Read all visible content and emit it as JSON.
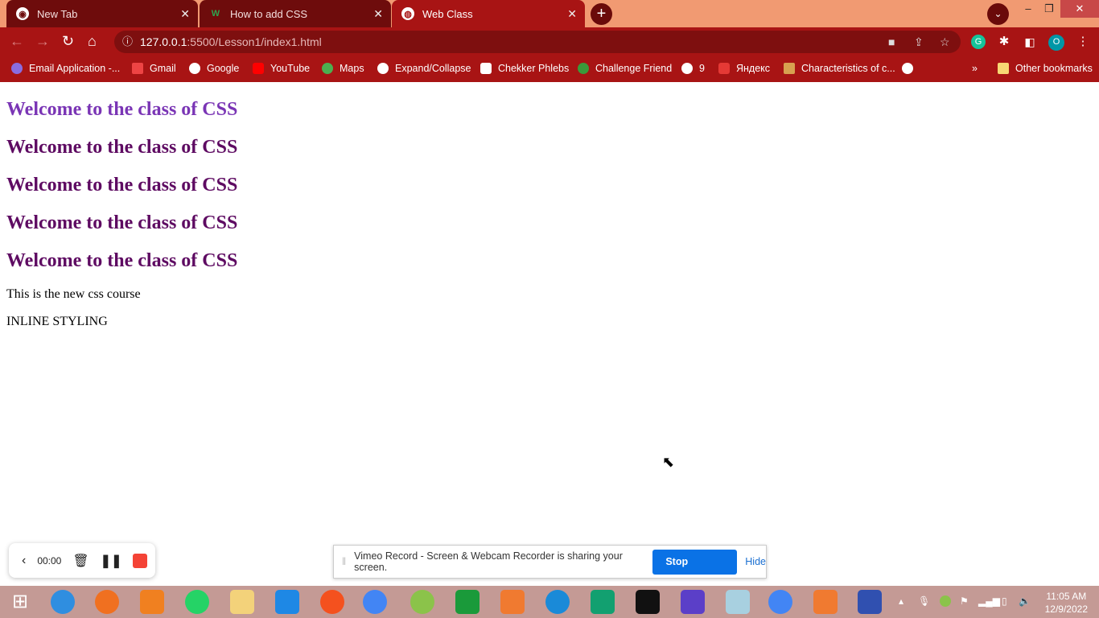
{
  "browser": {
    "tabs": [
      {
        "title": "New Tab",
        "icon": "chrome-icon"
      },
      {
        "title": "How to add CSS",
        "icon": "w3schools-icon"
      },
      {
        "title": "Web Class",
        "icon": "globe-icon",
        "active": true
      }
    ],
    "url_host": "127.0.0.1",
    "url_rest": ":5500/Lesson1/index1.html",
    "profile_initial": "O",
    "bookmarks": [
      "Email Application -...",
      "Gmail",
      "Google",
      "YouTube",
      "Maps",
      "Expand/Collapse",
      "Chekker Phlebs",
      "Challenge Friend",
      "9",
      "Яндекс",
      "Characteristics of c..."
    ],
    "other_bookmarks": "Other bookmarks",
    "more": "»"
  },
  "page": {
    "headings": [
      "Welcome to the class of CSS",
      "Welcome to the class of CSS",
      "Welcome to the class of CSS",
      "Welcome to the class of CSS",
      "Welcome to the class of CSS"
    ],
    "paragraph": "This is the new css course",
    "inline": "INLINE STYLING"
  },
  "recorder": {
    "time": "00:00"
  },
  "share_bar": {
    "message": "Vimeo Record - Screen & Webcam Recorder is sharing your screen.",
    "stop": "Stop sharing",
    "hide": "Hide"
  },
  "taskbar": {
    "time": "11:05 AM",
    "date": "12/9/2022"
  },
  "colors": {
    "tabstrip": "#f19a72",
    "toolbar": "#a81414",
    "heading1": "#7a35b5",
    "heading": "#5e0b62",
    "accent": "#0a72e6"
  }
}
